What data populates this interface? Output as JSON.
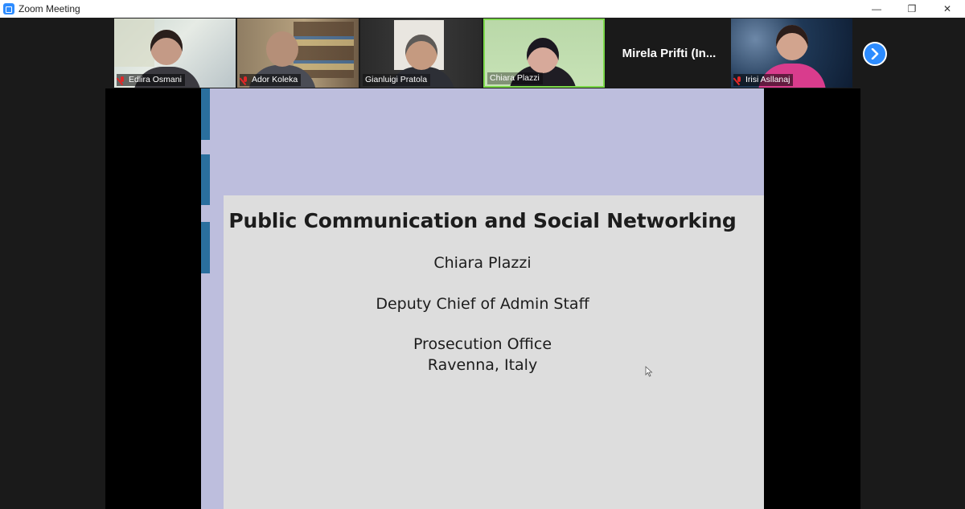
{
  "window": {
    "title": "Zoom Meeting",
    "controls": {
      "minimize": "—",
      "restore": "❐",
      "close": "✕"
    }
  },
  "participants": [
    {
      "name": "Edlira Osmani",
      "muted": true
    },
    {
      "name": "Ador Koleka",
      "muted": true
    },
    {
      "name": "Gianluigi Pratola",
      "muted": false
    },
    {
      "name": "Chiara Plazzi",
      "muted": false,
      "active_speaker": true
    },
    {
      "name": "Mirela Prifti (In...",
      "video": false
    },
    {
      "name": "Irisi Asllanaj",
      "muted": true
    }
  ],
  "gallery_next_icon": "chevron-right-icon",
  "slide": {
    "title": "Public Communication and Social Networking",
    "presenter": "Chiara Plazzi",
    "role": "Deputy Chief of Admin Staff",
    "office": "Prosecution Office",
    "location": "Ravenna, Italy"
  },
  "colors": {
    "zoom_blue": "#2d8cff",
    "active_speaker_border": "#7cd94b",
    "muted_mic": "#e02828",
    "slide_header": "#bdbedd",
    "slide_accent": "#2a6f9e"
  }
}
